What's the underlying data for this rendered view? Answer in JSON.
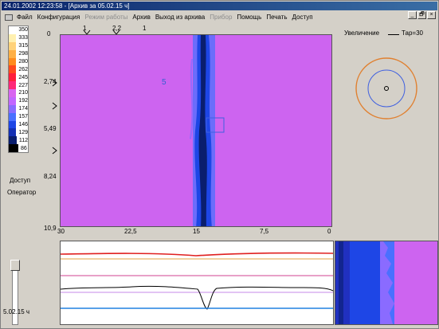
{
  "window": {
    "title": "24.01.2002  12:23:58 - [Архив за 05.02.15 ч]"
  },
  "menu": {
    "items": [
      {
        "label": "Файл",
        "disabled": false
      },
      {
        "label": "Конфигурация",
        "disabled": false
      },
      {
        "label": "Режим работы",
        "disabled": true
      },
      {
        "label": "Архив",
        "disabled": false
      },
      {
        "label": "Выход из архива",
        "disabled": false
      },
      {
        "label": "Прибор",
        "disabled": true
      },
      {
        "label": "Помощь",
        "disabled": false
      },
      {
        "label": "Печать",
        "disabled": false
      },
      {
        "label": "Доступ",
        "disabled": false
      }
    ]
  },
  "window_buttons": {
    "minimize": "_",
    "restore": "🗗",
    "close": "×"
  },
  "scale": {
    "rows": [
      {
        "value": "350",
        "color": "#ffffff"
      },
      {
        "value": "333",
        "color": "#fff0b0"
      },
      {
        "value": "315",
        "color": "#ffd27a"
      },
      {
        "value": "298",
        "color": "#ffb046"
      },
      {
        "value": "280",
        "color": "#ff8c1e"
      },
      {
        "value": "262",
        "color": "#ff4a1e"
      },
      {
        "value": "245",
        "color": "#ff1e3c"
      },
      {
        "value": "227",
        "color": "#ff2878"
      },
      {
        "value": "210",
        "color": "#d864f0"
      },
      {
        "value": "192",
        "color": "#c266ff"
      },
      {
        "value": "174",
        "color": "#8a6bff"
      },
      {
        "value": "157",
        "color": "#4a70ff"
      },
      {
        "value": "146",
        "color": "#1e46e6"
      },
      {
        "value": "129",
        "color": "#1430b4"
      },
      {
        "value": "112",
        "color": "#0a1e6e"
      },
      {
        "value": "86",
        "color": "#000000"
      }
    ]
  },
  "axes": {
    "y_ticks": [
      "0",
      "2,74",
      "5,49",
      "8,24",
      "10,9"
    ],
    "x_ticks": [
      "30",
      "22,5",
      "15",
      "7,5",
      "0"
    ],
    "top_markers": [
      "1",
      "2,2",
      "1"
    ],
    "region_label": "5"
  },
  "side": {
    "access_label": "Доступ",
    "operator_label": "Оператор"
  },
  "zoom": {
    "label": "Увеличение",
    "tar_label": "Тар=30"
  },
  "bottom": {
    "time_label": "5.02.15 ч"
  },
  "colors": {
    "heatmap_bg": "#cd64f0",
    "band_dark": "#0a1e6e",
    "band_mid": "#1e46e6",
    "band_light": "#4a70ff",
    "red_line": "#e02020",
    "orange_line": "#e0a040",
    "pink_line": "#d04090",
    "violet_line": "#b060e0",
    "blue_line": "#2080e0",
    "circle_outer": "#e08030",
    "circle_inner": "#4060e0"
  }
}
